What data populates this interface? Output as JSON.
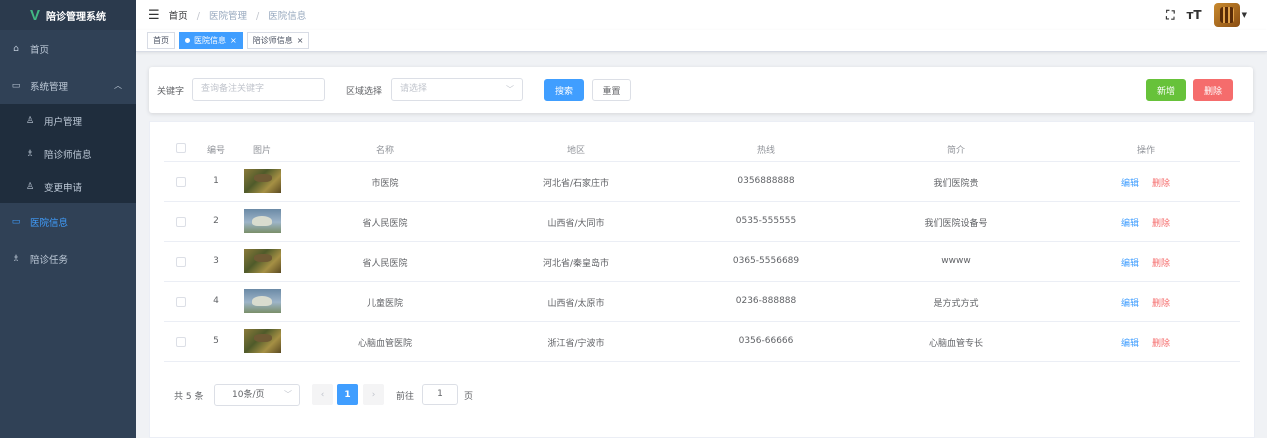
{
  "app": {
    "logo_letter": "V",
    "title": "陪诊管理系统",
    "accent": "#409eff"
  },
  "sidebar": {
    "items": [
      {
        "label": "首页",
        "icon": "home-icon"
      },
      {
        "label": "系统管理",
        "icon": "monitor-icon",
        "expanded": true
      },
      {
        "label": "用户管理",
        "icon": "user-icon",
        "sub": true
      },
      {
        "label": "陪诊师信息",
        "icon": "users-icon",
        "sub": true
      },
      {
        "label": "变更申请",
        "icon": "user-icon",
        "sub": true
      },
      {
        "label": "医院信息",
        "icon": "monitor-icon",
        "active": true
      },
      {
        "label": "陪诊任务",
        "icon": "users-icon"
      }
    ]
  },
  "header": {
    "breadcrumb": [
      "首页",
      "医院管理",
      "医院信息"
    ],
    "fullscreen_icon": "fullscreen-icon",
    "size_glyph": "тT"
  },
  "tags": [
    {
      "label": "首页",
      "active": false,
      "closable": false
    },
    {
      "label": "医院信息",
      "active": true,
      "closable": true
    },
    {
      "label": "陪诊师信息",
      "active": false,
      "closable": true
    }
  ],
  "search": {
    "keyword_label": "关键字",
    "keyword_placeholder": "查询备注关键字",
    "region_label": "区域选择",
    "region_placeholder": "请选择",
    "search_btn": "搜索",
    "reset_btn": "重置",
    "add_btn": "新增",
    "delete_btn": "删除"
  },
  "table": {
    "columns": [
      "编号",
      "图片",
      "名称",
      "地区",
      "热线",
      "简介",
      "操作"
    ],
    "edit_label": "编辑",
    "delete_label": "删除",
    "rows": [
      {
        "id": "1",
        "image": "grass",
        "name": "市医院",
        "region": "河北省/石家庄市",
        "hotline": "0356888888",
        "intro": "我们医院贵"
      },
      {
        "id": "2",
        "image": "dino",
        "name": "省人民医院",
        "region": "山西省/大同市",
        "hotline": "0535-555555",
        "intro": "我们医院设备号"
      },
      {
        "id": "3",
        "image": "grass",
        "name": "省人民医院",
        "region": "河北省/秦皇岛市",
        "hotline": "0365-5556689",
        "intro": "wwww"
      },
      {
        "id": "4",
        "image": "dino",
        "name": "儿童医院",
        "region": "山西省/太原市",
        "hotline": "0236-888888",
        "intro": "是方式方式"
      },
      {
        "id": "5",
        "image": "grass",
        "name": "心脑血管医院",
        "region": "浙江省/宁波市",
        "hotline": "0356-66666",
        "intro": "心脑血管专长"
      }
    ]
  },
  "pagination": {
    "total_text": "共 5 条",
    "page_size": "10条/页",
    "prev": "‹",
    "next": "›",
    "current_page": "1",
    "goto_label": "前往",
    "goto_value": "1",
    "page_suffix": "页"
  }
}
